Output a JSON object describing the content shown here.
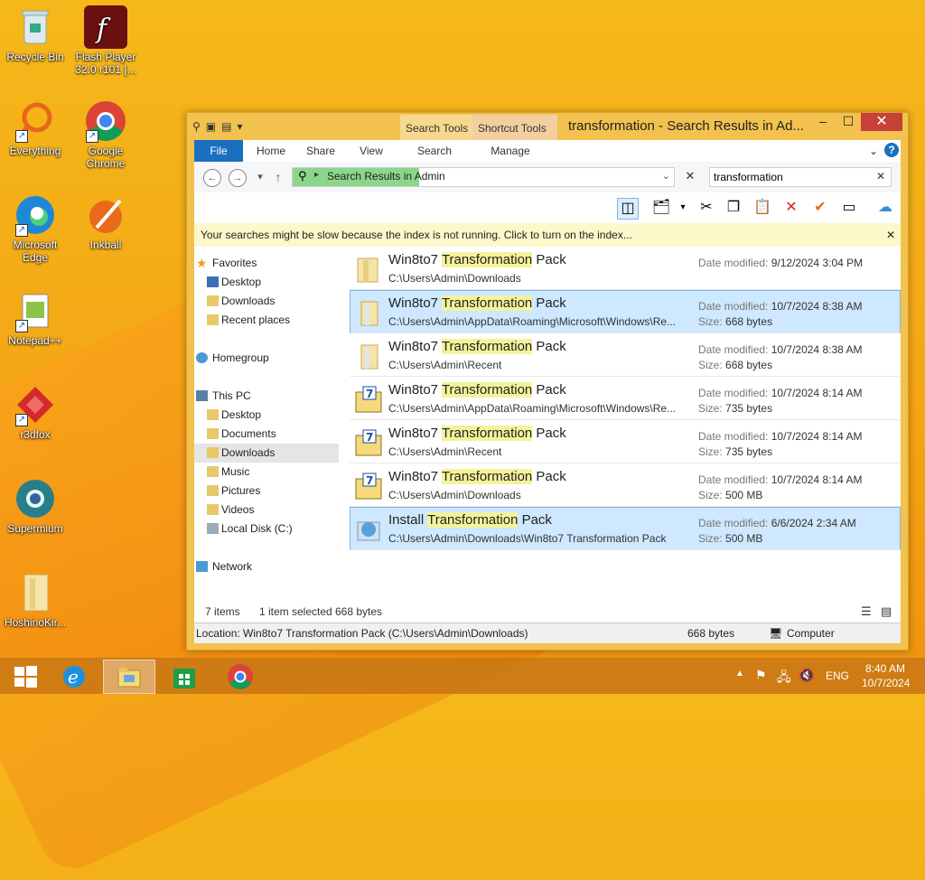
{
  "desktop": {
    "icons": [
      {
        "label": "Recycle Bin"
      },
      {
        "label": "Flash Player 32.0 r101 [..."
      },
      {
        "label": "Everything"
      },
      {
        "label": "Google Chrome"
      },
      {
        "label": "Microsoft Edge"
      },
      {
        "label": "Inkball"
      },
      {
        "label": "Notepad++"
      },
      {
        "label": "r3dfox"
      },
      {
        "label": "Supermium"
      },
      {
        "label": "HoshinoKir..."
      }
    ]
  },
  "window": {
    "title": "transformation - Search Results in Ad...",
    "context_tabs": [
      "Search Tools",
      "Shortcut Tools"
    ],
    "ribbon_tabs": [
      "File",
      "Home",
      "Share",
      "View",
      "Search",
      "Manage"
    ],
    "address": "Search Results in Admin",
    "search_value": "transformation",
    "info_bar": "Your searches might be slow because the index is not running.  Click to turn on the index...",
    "nav": {
      "favorites": "Favorites",
      "favorites_items": [
        "Desktop",
        "Downloads",
        "Recent places"
      ],
      "homegroup": "Homegroup",
      "this_pc": "This PC",
      "pc_items": [
        "Desktop",
        "Documents",
        "Downloads",
        "Music",
        "Pictures",
        "Videos",
        "Local Disk (C:)"
      ],
      "network": "Network"
    },
    "results": [
      {
        "pre": "Win8to7 ",
        "hl": "Transformation",
        "post": " Pack",
        "path": "C:\\Users\\Admin\\Downloads",
        "date_label": "Date modified:",
        "date": "9/12/2024 3:04 PM",
        "size_label": "",
        "size": ""
      },
      {
        "pre": "Win8to7 ",
        "hl": "Transformation",
        "post": " Pack",
        "path": "C:\\Users\\Admin\\AppData\\Roaming\\Microsoft\\Windows\\Re...",
        "date_label": "Date modified:",
        "date": "10/7/2024 8:38 AM",
        "size_label": "Size:",
        "size": "668 bytes"
      },
      {
        "pre": "Win8to7 ",
        "hl": "Transformation",
        "post": " Pack",
        "path": "C:\\Users\\Admin\\Recent",
        "date_label": "Date modified:",
        "date": "10/7/2024 8:38 AM",
        "size_label": "Size:",
        "size": "668 bytes"
      },
      {
        "pre": "Win8to7 ",
        "hl": "Transformation",
        "post": " Pack",
        "path": "C:\\Users\\Admin\\AppData\\Roaming\\Microsoft\\Windows\\Re...",
        "date_label": "Date modified:",
        "date": "10/7/2024 8:14 AM",
        "size_label": "Size:",
        "size": "735 bytes"
      },
      {
        "pre": "Win8to7 ",
        "hl": "Transformation",
        "post": " Pack",
        "path": "C:\\Users\\Admin\\Recent",
        "date_label": "Date modified:",
        "date": "10/7/2024 8:14 AM",
        "size_label": "Size:",
        "size": "735 bytes"
      },
      {
        "pre": "Win8to7 ",
        "hl": "Transformation",
        "post": " Pack",
        "path": "C:\\Users\\Admin\\Downloads",
        "date_label": "Date modified:",
        "date": "10/7/2024 8:14 AM",
        "size_label": "Size:",
        "size": "500 MB"
      },
      {
        "pre": "Install ",
        "hl": "Transformation",
        "post": " Pack",
        "path": "C:\\Users\\Admin\\Downloads\\Win8to7 Transformation Pack",
        "date_label": "Date modified:",
        "date": "6/6/2024 2:34 AM",
        "size_label": "Size:",
        "size": "500 MB"
      }
    ],
    "status": {
      "items": "7 items",
      "selected": "1 item selected",
      "sel_size": "668 bytes"
    },
    "location": "Location: Win8to7 Transformation Pack (C:\\Users\\Admin\\Downloads)",
    "location_size": "668 bytes",
    "location_zone": "Computer"
  },
  "taskbar": {
    "lang": "ENG",
    "time": "8:40 AM",
    "date": "10/7/2024"
  },
  "colors": {
    "accent": "#1a6fbf",
    "desktop": "#f4a715",
    "selected_row": "#cde8ff",
    "highlight": "#f4f39a"
  }
}
